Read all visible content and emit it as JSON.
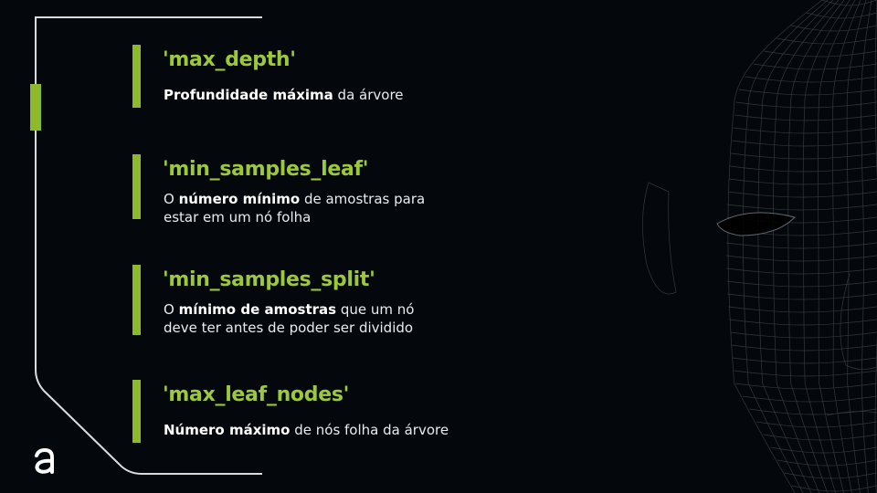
{
  "colors": {
    "accent": "#8dba2c",
    "title": "#9cc83a",
    "background": "#04080c",
    "text": "#e9ecef",
    "frame": "#d9dde0"
  },
  "logo": {
    "icon": "brand-a-logo"
  },
  "face": {
    "icon": "wireframe-face-illustration"
  },
  "params": [
    {
      "title": "'max_depth'",
      "desc_a": "",
      "desc_bold": "Profundidade máxima",
      "desc_b": " da árvore"
    },
    {
      "title": "'min_samples_leaf'",
      "desc_a": "O ",
      "desc_bold": "número mínimo",
      "desc_b": " de amostras para estar em um nó folha"
    },
    {
      "title": "'min_samples_split'",
      "desc_a": "O ",
      "desc_bold": "mínimo de amostras",
      "desc_b": " que um nó deve ter antes de poder ser dividido"
    },
    {
      "title": "'max_leaf_nodes'",
      "desc_a": "",
      "desc_bold": "Número máximo",
      "desc_b": " de nós folha da árvore"
    }
  ]
}
